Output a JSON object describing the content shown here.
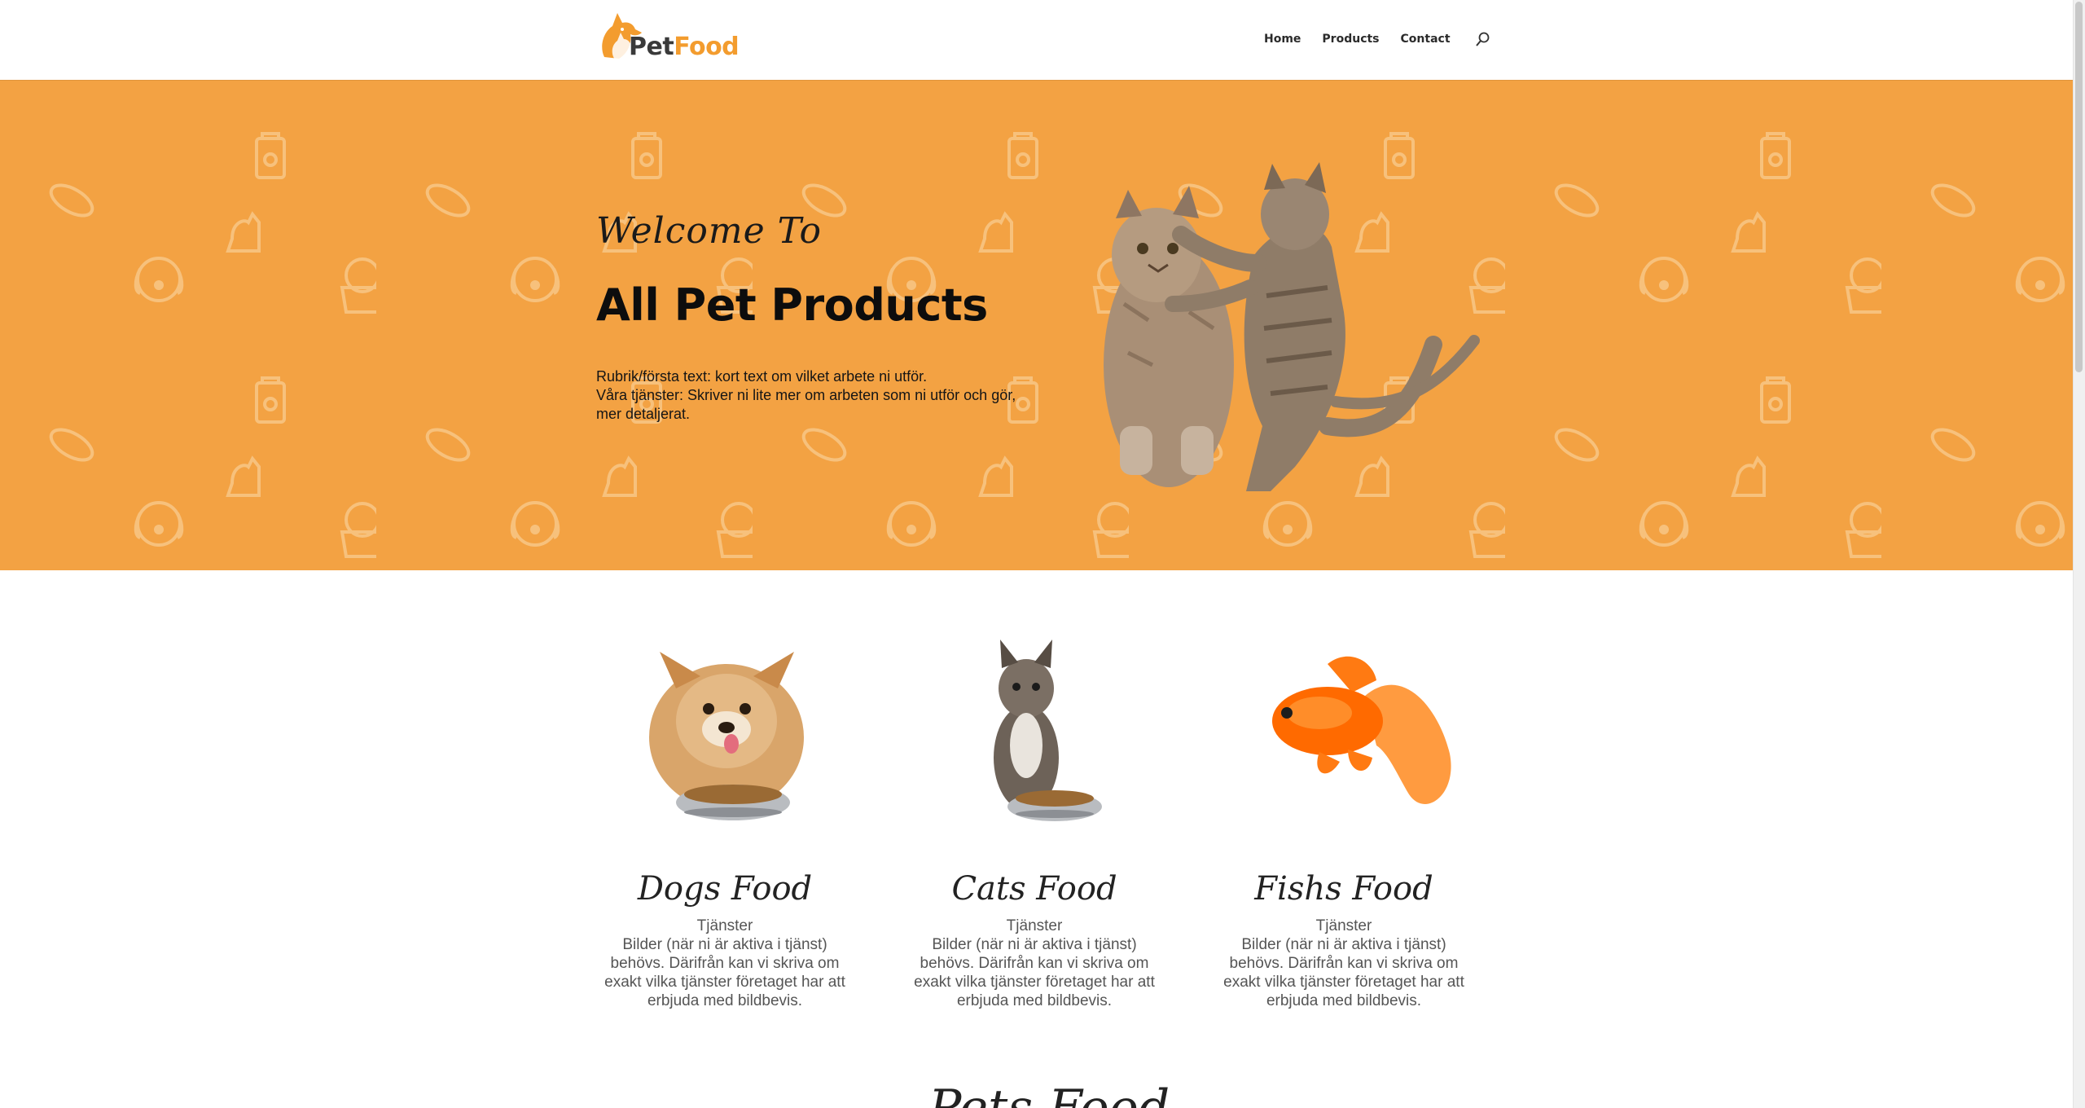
{
  "brand": {
    "logo_part1": "Pet",
    "logo_part2": "Food",
    "accent": "#f3a243",
    "logo_accent": "#f39c2e"
  },
  "nav": {
    "items": [
      "Home",
      "Products",
      "Contact"
    ],
    "search_icon": "search-icon"
  },
  "hero": {
    "welcome": "Welcome To",
    "title": "All Pet Products",
    "desc_line1": "Rubrik/första text: kort text om vilket arbete ni utför.",
    "desc_line2": "Våra tjänster: Skriver ni lite mer om arbeten som ni utför och gör, mer detaljerat.",
    "image": "two-cats-playing"
  },
  "products": [
    {
      "title": "Dogs Food",
      "subtitle": "Tjänster",
      "desc": "Bilder (när ni är aktiva i tjänst) behövs. Därifrån kan vi skriva om exakt vilka tjänster företaget har att erbjuda med bildbevis.",
      "image": "dog-with-food-bowl"
    },
    {
      "title": "Cats Food",
      "subtitle": "Tjänster",
      "desc": "Bilder (när ni är aktiva i tjänst) behövs. Därifrån kan vi skriva om exakt vilka tjänster företaget har att erbjuda med bildbevis.",
      "image": "kitten-with-food-bowl"
    },
    {
      "title": "Fishs Food",
      "subtitle": "Tjänster",
      "desc": "Bilder (när ni är aktiva i tjänst) behövs. Därifrån kan vi skriva om exakt vilka tjänster företaget har att erbjuda med bildbevis.",
      "image": "goldfish"
    }
  ],
  "next_section": {
    "heading": "Pets Food"
  }
}
